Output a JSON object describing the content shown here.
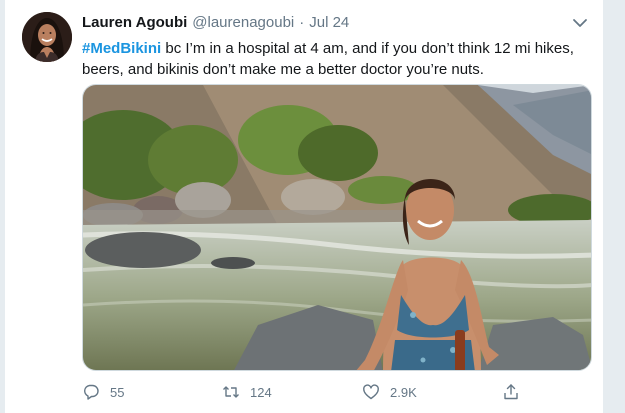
{
  "tweet": {
    "author_name": "Lauren Agoubi",
    "author_handle": "@laurenagoubi",
    "separator": "·",
    "date": "Jul 24",
    "hashtag": "#MedBikini",
    "body_line1": " bc I’m in a hospital at 4 am, and if you don’t think 12 mi hikes,",
    "body_line2": "beers, and bikinis don’t make me a better doctor you’re nuts."
  },
  "actions": {
    "replies": "55",
    "retweets": "124",
    "likes": "2.9K"
  },
  "icons": {
    "more": "chevron-down-icon",
    "reply": "reply-icon",
    "retweet": "retweet-icon",
    "like": "heart-icon",
    "share": "share-icon"
  },
  "colors": {
    "link": "#1b95e0",
    "secondary_text": "#657786",
    "background": "#e6ecf0"
  }
}
